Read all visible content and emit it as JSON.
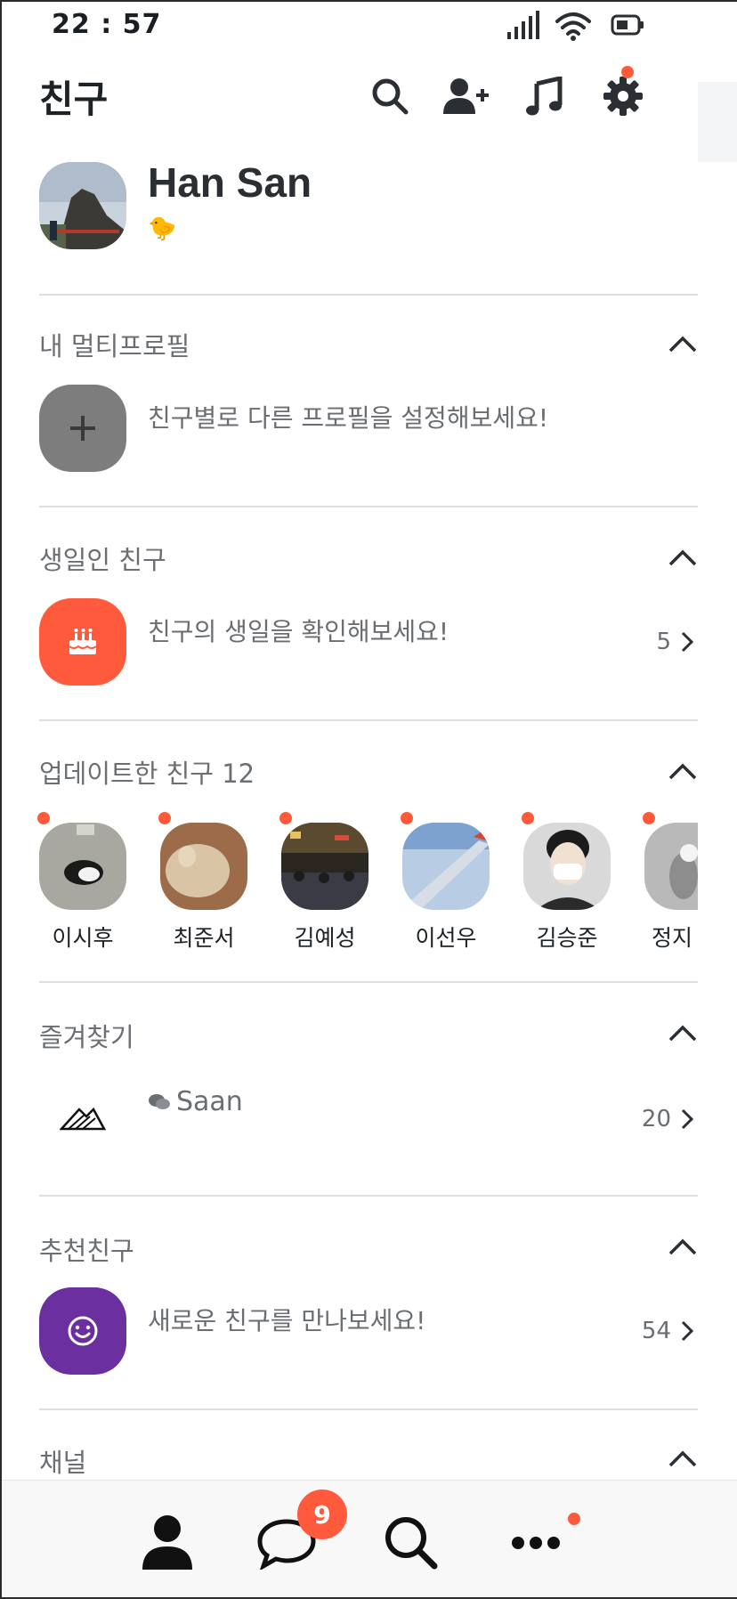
{
  "status_bar": {
    "time": "22 : 57"
  },
  "header": {
    "title": "친구"
  },
  "profile": {
    "name": "Han San",
    "status_emoji": "🐤"
  },
  "sections": {
    "multi_profile": {
      "title": "내 멀티프로필",
      "text": "친구별로 다른 프로필을 설정해보세요!"
    },
    "birthday": {
      "title": "생일인 친구",
      "text": "친구의 생일을 확인해보세요!",
      "count": "5"
    },
    "updated": {
      "title": "업데이트한 친구 12",
      "friends": [
        {
          "name": "이시후"
        },
        {
          "name": "최준서"
        },
        {
          "name": "김예성"
        },
        {
          "name": "이선우"
        },
        {
          "name": "김승준"
        },
        {
          "name": "정지"
        }
      ]
    },
    "favorites": {
      "title": "즐겨찾기",
      "name": "Saan",
      "count": "20"
    },
    "recommended": {
      "title": "추천친구",
      "text": "새로운 친구를 만나보세요!",
      "count": "54"
    },
    "channel": {
      "title": "채널"
    }
  },
  "bottom_nav": {
    "chat_badge": "9"
  },
  "colors": {
    "accent": "#ff5a3c",
    "multi_tile": "#7d7d7d",
    "birthday_tile": "#ff5a3c",
    "recommend_tile": "#6b2fa0"
  }
}
